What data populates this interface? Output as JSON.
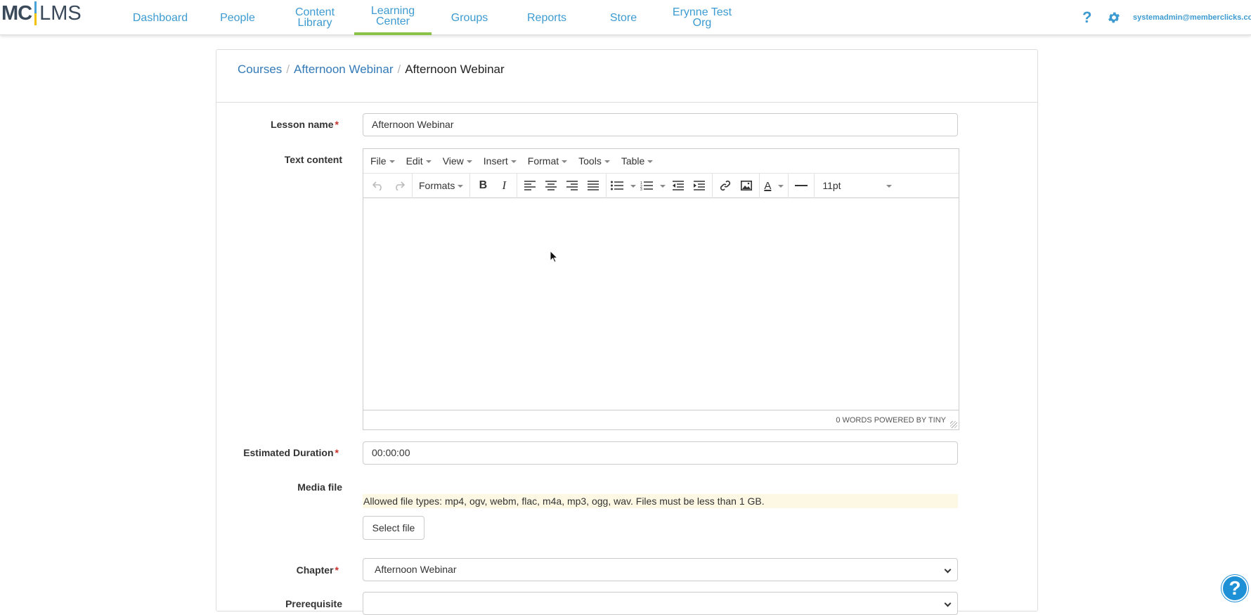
{
  "nav": {
    "logo_mc": "MC",
    "logo_lms": "LMS",
    "items": [
      {
        "label": "Dashboard"
      },
      {
        "label": "People"
      },
      {
        "label": "Content Library"
      },
      {
        "label": "Learning Center"
      },
      {
        "label": "Groups"
      },
      {
        "label": "Reports"
      },
      {
        "label": "Store"
      },
      {
        "label": "Erynne Test Org"
      }
    ],
    "help": "?",
    "user_email": "systemadmin@memberclicks.com"
  },
  "breadcrumb": {
    "items": [
      "Courses",
      "Afternoon Webinar"
    ],
    "current": "Afternoon Webinar",
    "separator": "/"
  },
  "form": {
    "lesson_name_label": "Lesson name",
    "lesson_name_value": "Afternoon Webinar",
    "text_content_label": "Text content",
    "required_mark": "*",
    "duration_label": "Estimated Duration",
    "duration_value": "00:00:00",
    "media_label": "Media file",
    "media_note": "Allowed file types: mp4, ogv, webm, flac, m4a, mp3, ogg, wav. Files must be less than 1 GB.",
    "select_file": "Select file",
    "chapter_label": "Chapter",
    "chapter_value": "Afternoon Webinar",
    "prereq_label": "Prerequisite"
  },
  "editor": {
    "menus": [
      "File",
      "Edit",
      "View",
      "Insert",
      "Format",
      "Tools",
      "Table"
    ],
    "formats": "Formats",
    "font_size": "11pt",
    "status": "0 WORDS POWERED BY TINY"
  },
  "fab": "?"
}
